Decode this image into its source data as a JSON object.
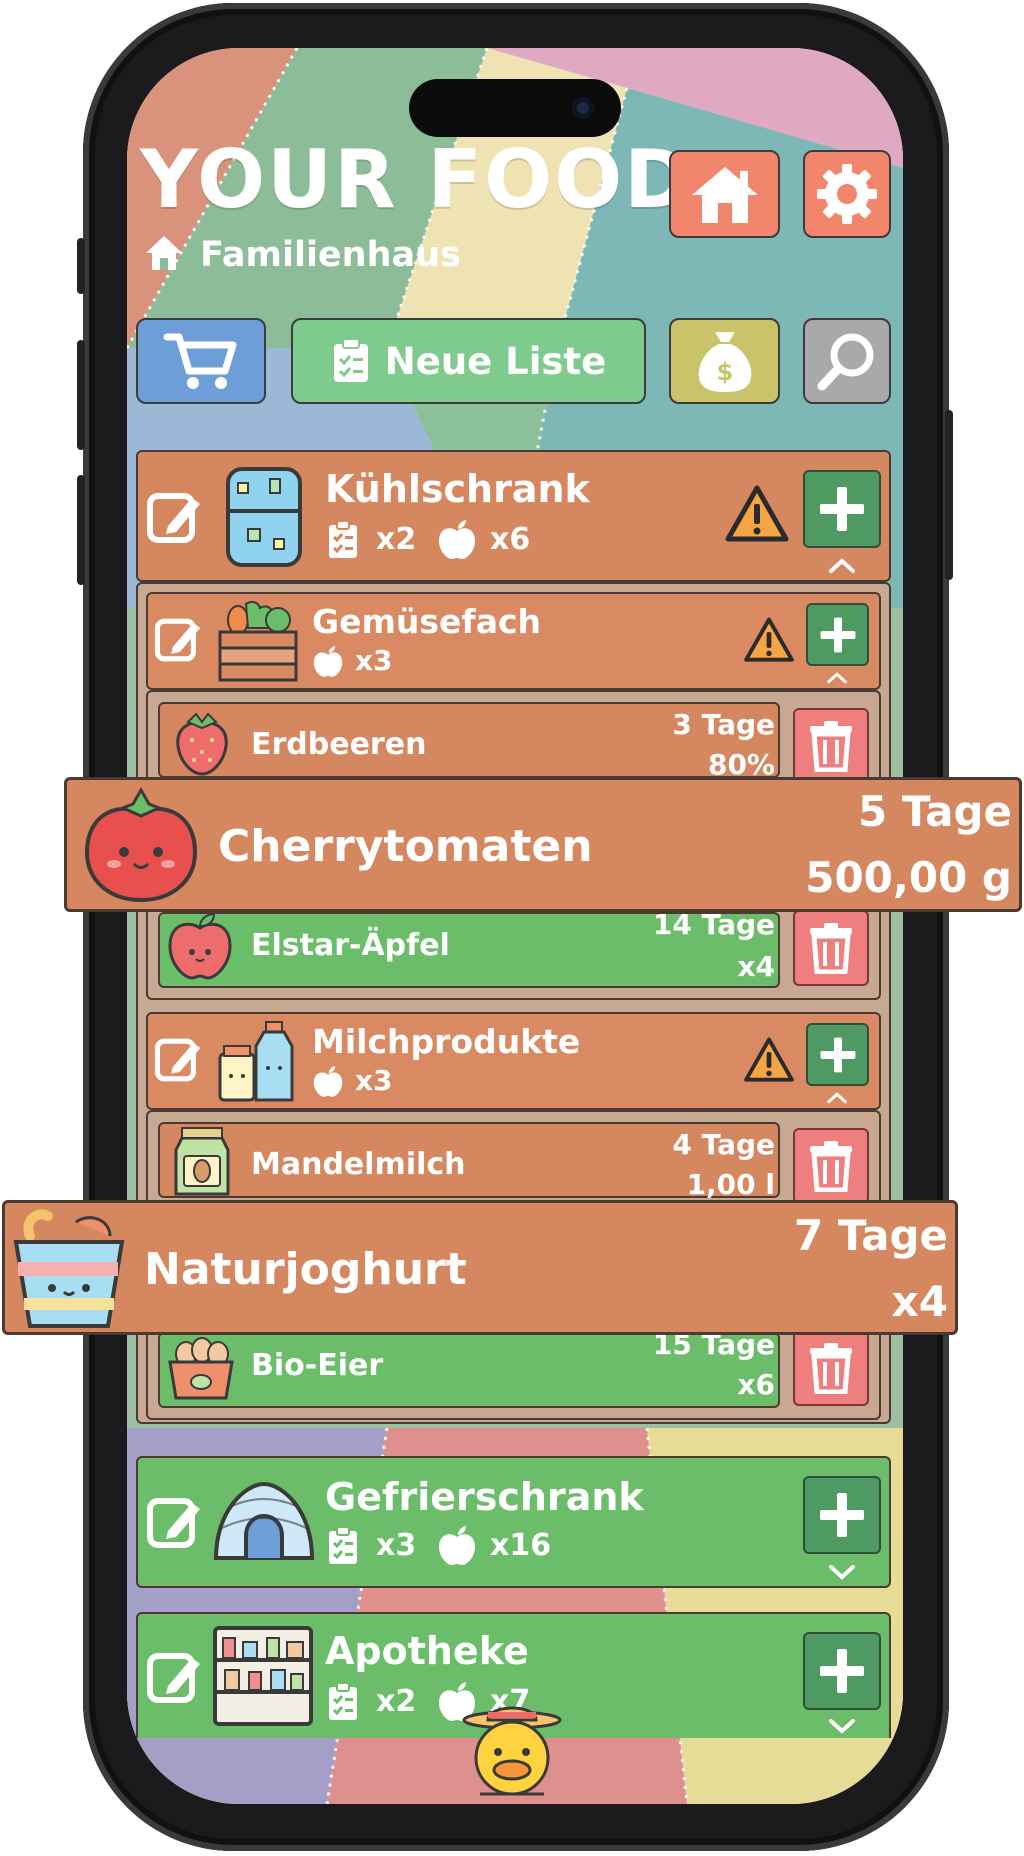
{
  "app": {
    "title": "YOUR FOOD",
    "household": "Familienhaus"
  },
  "colors": {
    "orange": "#d5875f",
    "green": "#6cbd6a",
    "plus": "#4f9a62",
    "trash": "#ef7f7f",
    "cart": "#6e9ed8",
    "list": "#7ecb8d",
    "money": "#c9c36a",
    "search": "#a9a9a9",
    "header_btn": "#f2866c"
  },
  "toolbar": {
    "new_list_label": "Neue Liste"
  },
  "storages": [
    {
      "name": "Kühlschrank",
      "lists": "x2",
      "items": "x6"
    },
    {
      "name": "Gefrierschrank",
      "lists": "x3",
      "items": "x16"
    },
    {
      "name": "Apotheke",
      "lists": "x2",
      "items": "x7"
    }
  ],
  "compartments": [
    {
      "name": "Gemüsefach",
      "items": "x3"
    },
    {
      "name": "Milchprodukte",
      "items": "x3"
    }
  ],
  "foods": [
    {
      "name": "Erdbeeren",
      "days": "3 Tage",
      "amount": "80%"
    },
    {
      "name": "Cherrytomaten",
      "days": "5 Tage",
      "amount": "500,00 g"
    },
    {
      "name": "Elstar-Äpfel",
      "days": "14 Tage",
      "amount": "x4"
    },
    {
      "name": "Mandelmilch",
      "days": "4 Tage",
      "amount": "1,00 l"
    },
    {
      "name": "Naturjoghurt",
      "days": "7 Tage",
      "amount": "x4"
    },
    {
      "name": "Bio-Eier",
      "days": "15 Tage",
      "amount": "x6"
    }
  ]
}
